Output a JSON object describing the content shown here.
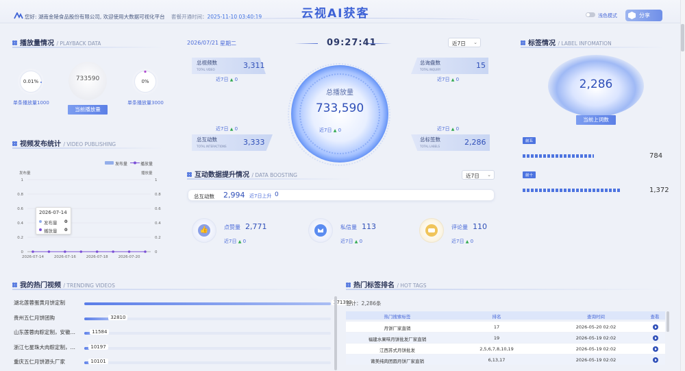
{
  "header": {
    "greeting": "您好: 湖南金陵食品股份有限公司, 欢迎使用大数据可视化平台",
    "open_time_label": "套餐开通时间：",
    "open_time_value": "2025-11-10 03:40:19",
    "brand": "云视AI获客",
    "theme_toggle_label": "浅色模式",
    "share_label": "分享"
  },
  "playback": {
    "title": "播放量情况",
    "title_en": "/ PLAYBACK DATA",
    "left_ring_value": "0.01%",
    "left_label": "单条播放量1000",
    "center_value": "733590",
    "center_button": "当前播放量",
    "right_ring_value": "0%",
    "right_label": "单条播放量3000"
  },
  "publishing": {
    "title": "视频发布统计",
    "title_en": "/ VIDEO PUBLISHING",
    "legend": [
      "发布量",
      "播放量"
    ],
    "left_axis_title": "发布量",
    "right_axis_title": "播放量",
    "tooltip_date": "2026-07-14",
    "tooltip_rows": [
      {
        "label": "发布量",
        "value": "0"
      },
      {
        "label": "播放量",
        "value": "0"
      }
    ]
  },
  "chart_data": {
    "type": "line",
    "title": "",
    "x": [
      "2026-07-14",
      "2026-07-15",
      "2026-07-16",
      "2026-07-17",
      "2026-07-18",
      "2026-07-19",
      "2026-07-20",
      "2026-07-21"
    ],
    "x_tick_labels": [
      "2026-07-14",
      "2026-07-16",
      "2026-07-18",
      "2026-07-20"
    ],
    "y_ticks": [
      "0",
      "0.2",
      "0.4",
      "0.6",
      "0.8",
      "1"
    ],
    "ylim": [
      0,
      1
    ],
    "series": [
      {
        "name": "发布量",
        "type": "bar",
        "color": "#93aeea",
        "values": [
          0,
          0,
          0,
          0,
          0,
          0,
          0,
          0
        ]
      },
      {
        "name": "播放量",
        "type": "line",
        "color": "#7b4fd6",
        "values": [
          0,
          0,
          0,
          0,
          0,
          0,
          0,
          0
        ]
      }
    ],
    "grid": true,
    "legend": "top-right"
  },
  "center": {
    "date": "2026/07/21",
    "weekday": "星期二",
    "clock": "09:27:41",
    "range_select": "近7日",
    "orb_label": "总播放量",
    "orb_value": "733,590",
    "orb_trend_label": "近7日",
    "orb_trend_value": "0",
    "cards": [
      {
        "name": "总视频数",
        "en": "TOTAL VIDEO",
        "value": "3,311",
        "trend_label": "近7日",
        "trend_value": "0"
      },
      {
        "name": "总询盘数",
        "en": "TOTAL INQUIRY",
        "value": "15",
        "trend_label": "近7日",
        "trend_value": "0"
      },
      {
        "name": "总互动数",
        "en": "TOTAL INTERACTIONS",
        "value": "3,333",
        "trend_label": "近7日",
        "trend_value": "0"
      },
      {
        "name": "总标签数",
        "en": "TOTAL LABELS",
        "value": "2,286",
        "trend_label": "近7日",
        "trend_value": "0"
      }
    ]
  },
  "boosting": {
    "title": "互动数据提升情况",
    "title_en": "/ DATA BOOSTING",
    "range_select": "近7日",
    "total_label": "总互动数",
    "total_value": "2,994",
    "total_change_label": "近7日上升",
    "total_change_value": "0",
    "items": [
      {
        "icon": "thumbs-up-icon",
        "name": "点赞量",
        "value": "2,771",
        "trend_label": "近7日",
        "trend_value": "0",
        "color": "#8a9fe6"
      },
      {
        "icon": "message-icon",
        "name": "私信量",
        "value": "113",
        "trend_label": "近7日",
        "trend_value": "0",
        "color": "#5b8cf0"
      },
      {
        "icon": "comment-icon",
        "name": "评论量",
        "value": "110",
        "trend_label": "近7日",
        "trend_value": "0",
        "color": "#f0c45a"
      }
    ]
  },
  "labels": {
    "title": "标签情况",
    "title_en": "/ LABEL INFOMATION",
    "value": "2,286",
    "button": "当前上词数",
    "bars": [
      {
        "tag": "前五",
        "value": "784",
        "fill": 0.58
      },
      {
        "tag": "前十",
        "value": "1,372",
        "fill": 0.8
      }
    ]
  },
  "trending": {
    "title": "我的热门视频",
    "title_en": "/ TRENDING VIDEOS",
    "rows": [
      {
        "name": "湖北莲蓉蛋黄月饼定制",
        "value": "271393",
        "fill": 1.0
      },
      {
        "name": "贵州五仁月饼团购",
        "value": "32810",
        "fill": 0.12
      },
      {
        "name": "山东莲蓉肉粽定制，安徽…",
        "value": "11584",
        "fill": 0.045
      },
      {
        "name": "浙江七星珠大肉粽定制，…",
        "value": "10197",
        "fill": 0.04
      },
      {
        "name": "重庆五仁月饼源头厂家",
        "value": "10101",
        "fill": 0.04
      }
    ]
  },
  "hottags": {
    "title": "热门标签排名",
    "title_en": "/ HOT TAGS",
    "total": "总计：2,286条",
    "headers": [
      "热门搜索标签",
      "排名",
      "查询时间",
      "查看"
    ],
    "rows": [
      {
        "tag": "月饼厂家直销",
        "rank": "17",
        "time": "2026-05-20 02:02"
      },
      {
        "tag": "福建水果味月饼批发厂家直销",
        "rank": "19",
        "time": "2026-05-19 02:02"
      },
      {
        "tag": "江西苏式月饼批发",
        "rank": "2,5,6,7,8,10,19",
        "time": "2026-05-19 02:02"
      },
      {
        "tag": "莆美纯肉团圆月饼厂家直销",
        "rank": "6,13,17",
        "time": "2026-05-19 02:02"
      }
    ]
  }
}
